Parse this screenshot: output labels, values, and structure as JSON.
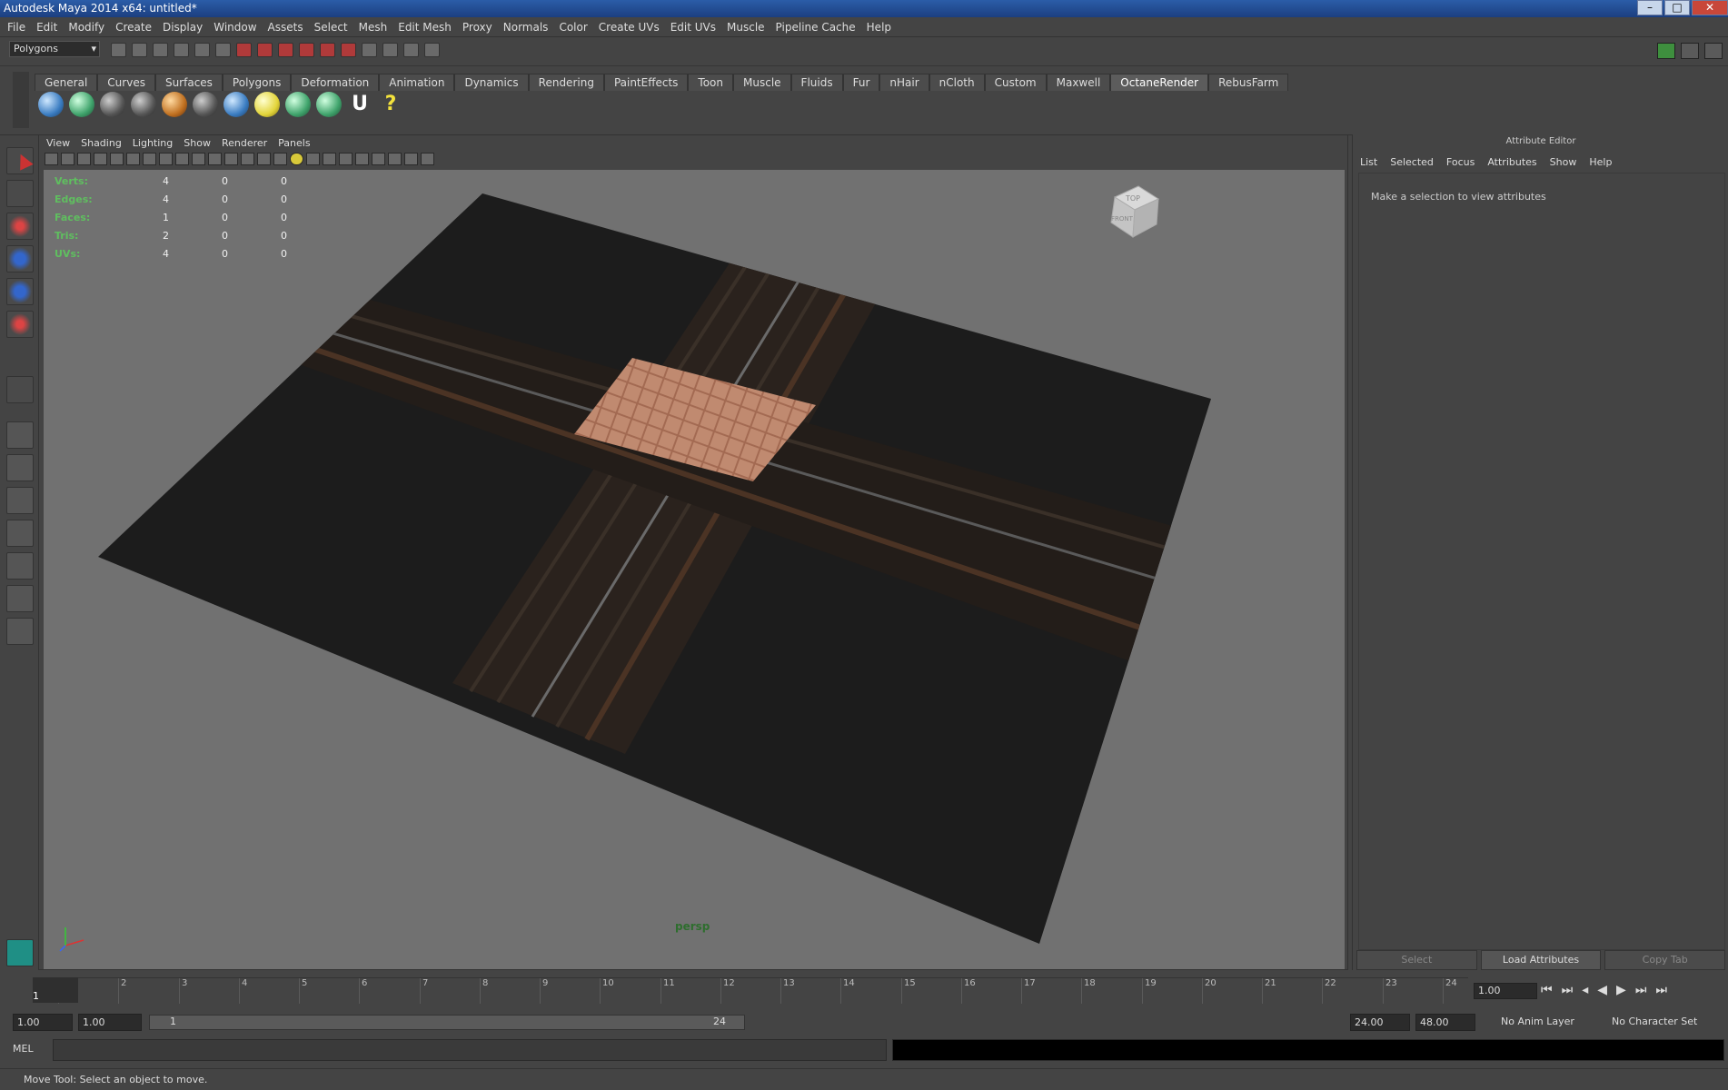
{
  "window": {
    "title": "Autodesk Maya 2014 x64: untitled*"
  },
  "menu": [
    "File",
    "Edit",
    "Modify",
    "Create",
    "Display",
    "Window",
    "Assets",
    "Select",
    "Mesh",
    "Edit Mesh",
    "Proxy",
    "Normals",
    "Color",
    "Create UVs",
    "Edit UVs",
    "Muscle",
    "Pipeline Cache",
    "Help"
  ],
  "status_line": {
    "mode": "Polygons"
  },
  "shelf": {
    "tabs": [
      "General",
      "Curves",
      "Surfaces",
      "Polygons",
      "Deformation",
      "Animation",
      "Dynamics",
      "Rendering",
      "PaintEffects",
      "Toon",
      "Muscle",
      "Fluids",
      "Fur",
      "nHair",
      "nCloth",
      "Custom",
      "Maxwell",
      "OctaneRender",
      "RebusFarm"
    ],
    "active_tab": "OctaneRender",
    "icons": [
      "octane-sphere-icon",
      "octane-env-icon",
      "octane-camera-icon",
      "octane-settings-icon",
      "octane-material-icon",
      "octane-render-icon",
      "octane-texture-icon",
      "light-bulb-icon",
      "leaf-icon",
      "leaf-alt-icon",
      "u-icon",
      "help-icon"
    ]
  },
  "panel": {
    "menu": [
      "View",
      "Shading",
      "Lighting",
      "Show",
      "Renderer",
      "Panels"
    ],
    "camera": "persp",
    "hud": [
      {
        "label": "Verts:",
        "values": [
          "4",
          "0",
          "0"
        ]
      },
      {
        "label": "Edges:",
        "values": [
          "4",
          "0",
          "0"
        ]
      },
      {
        "label": "Faces:",
        "values": [
          "1",
          "0",
          "0"
        ]
      },
      {
        "label": "Tris:",
        "values": [
          "2",
          "0",
          "0"
        ]
      },
      {
        "label": "UVs:",
        "values": [
          "4",
          "0",
          "0"
        ]
      }
    ],
    "viewcube": {
      "top": "TOP",
      "front": "FRONT"
    }
  },
  "attribute_editor": {
    "title": "Attribute Editor",
    "menu": [
      "List",
      "Selected",
      "Focus",
      "Attributes",
      "Show",
      "Help"
    ],
    "message": "Make a selection to view attributes",
    "buttons": {
      "select": "Select",
      "load": "Load Attributes",
      "copy": "Copy Tab"
    }
  },
  "time_slider": {
    "frames": [
      "1",
      "2",
      "3",
      "4",
      "5",
      "6",
      "7",
      "8",
      "9",
      "10",
      "11",
      "12",
      "13",
      "14",
      "15",
      "16",
      "17",
      "18",
      "19",
      "20",
      "21",
      "22",
      "23",
      "24"
    ],
    "current": "1",
    "current_field": "1.00"
  },
  "range": {
    "start": "1.00",
    "anim_start": "1.00",
    "slider_start": "1",
    "slider_end": "24",
    "end": "24.00",
    "anim_end": "48.00",
    "anim_layer": "No Anim Layer",
    "character_set": "No Character Set"
  },
  "command_line": {
    "label": "MEL"
  },
  "help_line": "Move Tool: Select an object to move."
}
